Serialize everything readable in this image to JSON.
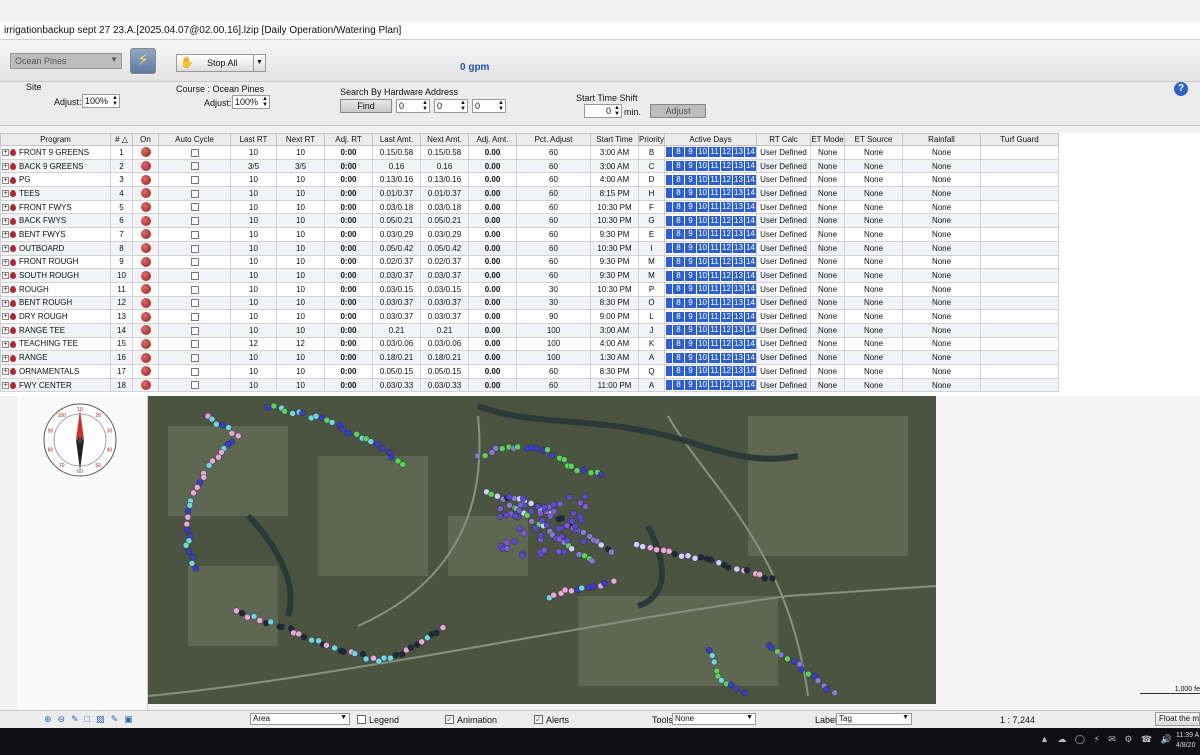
{
  "window": {
    "title": "irrigationbackup sept 27 23.A.[2025.04.07@02.00.16].lzip   [Daily Operation/Watering Plan]"
  },
  "toolbar": {
    "site_selected": "Ocean Pines",
    "stop_all": "Stop All",
    "flow": "0 gpm"
  },
  "controls": {
    "site_label": "Site",
    "site_adjust_label": "Adjust:",
    "site_adjust": "100%",
    "course_label": "Course : Ocean Pines",
    "course_adjust_label": "Adjust:",
    "course_adjust": "100%",
    "search_label": "Search By Hardware Address",
    "find": "Find",
    "addr1": "0",
    "addr2": "0",
    "addr3": "0",
    "shift_label": "Start Time Shift",
    "shift_value": "0",
    "shift_unit": "min.",
    "adjust_btn": "Adjust",
    "help": "?"
  },
  "columns": [
    "Program",
    "# △",
    "On",
    "Auto Cycle",
    "Last RT",
    "Next RT",
    "Adj. RT",
    "Last Amt.",
    "Next Amt.",
    "Adj. Amt.",
    "Pct. Adjust",
    "Start Time",
    "Priority",
    "Active Days",
    "RT Calc",
    "ET Mode",
    "ET Source",
    "Rainfall",
    "Turf Guard"
  ],
  "days": [
    "8",
    "9",
    "10",
    "11",
    "12",
    "13",
    "14"
  ],
  "rows": [
    {
      "name": "FRONT 9 GREENS",
      "num": "1",
      "last_rt": "10",
      "next_rt": "10",
      "adj_rt": "0:00",
      "last_amt": "0.15/0.58",
      "next_amt": "0.15/0.58",
      "adj_amt": "0.00",
      "pct": "60",
      "start": "3:00 AM",
      "priority": "B",
      "rt_calc": "User Defined",
      "et_mode": "None",
      "et_source": "None",
      "rainfall": "None"
    },
    {
      "name": "BACK 9 GREENS",
      "num": "2",
      "last_rt": "3/5",
      "next_rt": "3/5",
      "adj_rt": "0:00",
      "last_amt": "0.16",
      "next_amt": "0.16",
      "adj_amt": "0.00",
      "pct": "60",
      "start": "3:00 AM",
      "priority": "C",
      "rt_calc": "User Defined",
      "et_mode": "None",
      "et_source": "None",
      "rainfall": "None"
    },
    {
      "name": "PG",
      "num": "3",
      "last_rt": "10",
      "next_rt": "10",
      "adj_rt": "0:00",
      "last_amt": "0.13/0.16",
      "next_amt": "0.13/0.16",
      "adj_amt": "0.00",
      "pct": "60",
      "start": "4:00 AM",
      "priority": "D",
      "rt_calc": "User Defined",
      "et_mode": "None",
      "et_source": "None",
      "rainfall": "None"
    },
    {
      "name": "TEES",
      "num": "4",
      "last_rt": "10",
      "next_rt": "10",
      "adj_rt": "0:00",
      "last_amt": "0.01/0.37",
      "next_amt": "0.01/0.37",
      "adj_amt": "0.00",
      "pct": "60",
      "start": "8:15 PM",
      "priority": "H",
      "rt_calc": "User Defined",
      "et_mode": "None",
      "et_source": "None",
      "rainfall": "None"
    },
    {
      "name": "FRONT FWYS",
      "num": "5",
      "last_rt": "10",
      "next_rt": "10",
      "adj_rt": "0:00",
      "last_amt": "0.03/0.18",
      "next_amt": "0.03/0.18",
      "adj_amt": "0.00",
      "pct": "60",
      "start": "10:30 PM",
      "priority": "F",
      "rt_calc": "User Defined",
      "et_mode": "None",
      "et_source": "None",
      "rainfall": "None"
    },
    {
      "name": "BACK FWYS",
      "num": "6",
      "last_rt": "10",
      "next_rt": "10",
      "adj_rt": "0:00",
      "last_amt": "0.05/0.21",
      "next_amt": "0.05/0.21",
      "adj_amt": "0.00",
      "pct": "60",
      "start": "10:30 PM",
      "priority": "G",
      "rt_calc": "User Defined",
      "et_mode": "None",
      "et_source": "None",
      "rainfall": "None"
    },
    {
      "name": "BENT FWYS",
      "num": "7",
      "last_rt": "10",
      "next_rt": "10",
      "adj_rt": "0:00",
      "last_amt": "0.03/0.29",
      "next_amt": "0.03/0.29",
      "adj_amt": "0.00",
      "pct": "60",
      "start": "9:30 PM",
      "priority": "E",
      "rt_calc": "User Defined",
      "et_mode": "None",
      "et_source": "None",
      "rainfall": "None"
    },
    {
      "name": "OUTBOARD",
      "num": "8",
      "last_rt": "10",
      "next_rt": "10",
      "adj_rt": "0:00",
      "last_amt": "0.05/0.42",
      "next_amt": "0.05/0.42",
      "adj_amt": "0.00",
      "pct": "60",
      "start": "10:30 PM",
      "priority": "I",
      "rt_calc": "User Defined",
      "et_mode": "None",
      "et_source": "None",
      "rainfall": "None"
    },
    {
      "name": "FRONT ROUGH",
      "num": "9",
      "last_rt": "10",
      "next_rt": "10",
      "adj_rt": "0:00",
      "last_amt": "0.02/0.37",
      "next_amt": "0.02/0.37",
      "adj_amt": "0.00",
      "pct": "60",
      "start": "9:30 PM",
      "priority": "M",
      "rt_calc": "User Defined",
      "et_mode": "None",
      "et_source": "None",
      "rainfall": "None"
    },
    {
      "name": "SOUTH ROUGH",
      "num": "10",
      "last_rt": "10",
      "next_rt": "10",
      "adj_rt": "0:00",
      "last_amt": "0.03/0.37",
      "next_amt": "0.03/0.37",
      "adj_amt": "0.00",
      "pct": "60",
      "start": "9:30 PM",
      "priority": "M",
      "rt_calc": "User Defined",
      "et_mode": "None",
      "et_source": "None",
      "rainfall": "None"
    },
    {
      "name": "ROUGH",
      "num": "11",
      "last_rt": "10",
      "next_rt": "10",
      "adj_rt": "0:00",
      "last_amt": "0.03/0.15",
      "next_amt": "0.03/0.15",
      "adj_amt": "0.00",
      "pct": "30",
      "start": "10:30 PM",
      "priority": "P",
      "rt_calc": "User Defined",
      "et_mode": "None",
      "et_source": "None",
      "rainfall": "None"
    },
    {
      "name": "BENT ROUGH",
      "num": "12",
      "last_rt": "10",
      "next_rt": "10",
      "adj_rt": "0:00",
      "last_amt": "0.03/0.37",
      "next_amt": "0.03/0.37",
      "adj_amt": "0.00",
      "pct": "30",
      "start": "8:30 PM",
      "priority": "O",
      "rt_calc": "User Defined",
      "et_mode": "None",
      "et_source": "None",
      "rainfall": "None"
    },
    {
      "name": "DRY ROUGH",
      "num": "13",
      "last_rt": "10",
      "next_rt": "10",
      "adj_rt": "0:00",
      "last_amt": "0.03/0.37",
      "next_amt": "0.03/0.37",
      "adj_amt": "0.00",
      "pct": "90",
      "start": "9:00 PM",
      "priority": "L",
      "rt_calc": "User Defined",
      "et_mode": "None",
      "et_source": "None",
      "rainfall": "None"
    },
    {
      "name": "RANGE TEE",
      "num": "14",
      "last_rt": "10",
      "next_rt": "10",
      "adj_rt": "0:00",
      "last_amt": "0.21",
      "next_amt": "0.21",
      "adj_amt": "0.00",
      "pct": "100",
      "start": "3:00 AM",
      "priority": "J",
      "rt_calc": "User Defined",
      "et_mode": "None",
      "et_source": "None",
      "rainfall": "None"
    },
    {
      "name": "TEACHING TEE",
      "num": "15",
      "last_rt": "12",
      "next_rt": "12",
      "adj_rt": "0:00",
      "last_amt": "0.03/0.06",
      "next_amt": "0.03/0.06",
      "adj_amt": "0.00",
      "pct": "100",
      "start": "4:00 AM",
      "priority": "K",
      "rt_calc": "User Defined",
      "et_mode": "None",
      "et_source": "None",
      "rainfall": "None"
    },
    {
      "name": "RANGE",
      "num": "16",
      "last_rt": "10",
      "next_rt": "10",
      "adj_rt": "0:00",
      "last_amt": "0.18/0.21",
      "next_amt": "0.18/0.21",
      "adj_amt": "0.00",
      "pct": "100",
      "start": "1:30 AM",
      "priority": "A",
      "rt_calc": "User Defined",
      "et_mode": "None",
      "et_source": "None",
      "rainfall": "None"
    },
    {
      "name": "ORNAMENTALS",
      "num": "17",
      "last_rt": "10",
      "next_rt": "10",
      "adj_rt": "0:00",
      "last_amt": "0.05/0.15",
      "next_amt": "0.05/0.15",
      "adj_amt": "0.00",
      "pct": "60",
      "start": "8:30 PM",
      "priority": "Q",
      "rt_calc": "User Defined",
      "et_mode": "None",
      "et_source": "None",
      "rainfall": "None"
    },
    {
      "name": "FWY CENTER",
      "num": "18",
      "last_rt": "10",
      "next_rt": "10",
      "adj_rt": "0:00",
      "last_amt": "0.03/0.33",
      "next_amt": "0.03/0.33",
      "adj_amt": "0.00",
      "pct": "60",
      "start": "11:00 PM",
      "priority": "A",
      "rt_calc": "User Defined",
      "et_mode": "None",
      "et_source": "None",
      "rainfall": "None"
    }
  ],
  "map": {
    "compass_labels": [
      "10",
      "20",
      "30",
      "40",
      "50",
      "60",
      "70",
      "80",
      "90",
      "100"
    ],
    "scale_label": "1,000 fe"
  },
  "statusbar": {
    "area": "Area",
    "legend": "Legend",
    "animation": "Animation",
    "alerts": "Alerts",
    "tools_label": "Tools",
    "tools_value": "None",
    "label_label": "Label",
    "label_value": "Tag",
    "scale": "1 : 7,244",
    "float": "Float the map"
  },
  "taskbar": {
    "time": "11:39 A",
    "date": "4/8/20"
  },
  "colors": {
    "day_active": "#2c5fd6",
    "on_indicator": "#b3262b",
    "flow": "#1f4fbf"
  }
}
